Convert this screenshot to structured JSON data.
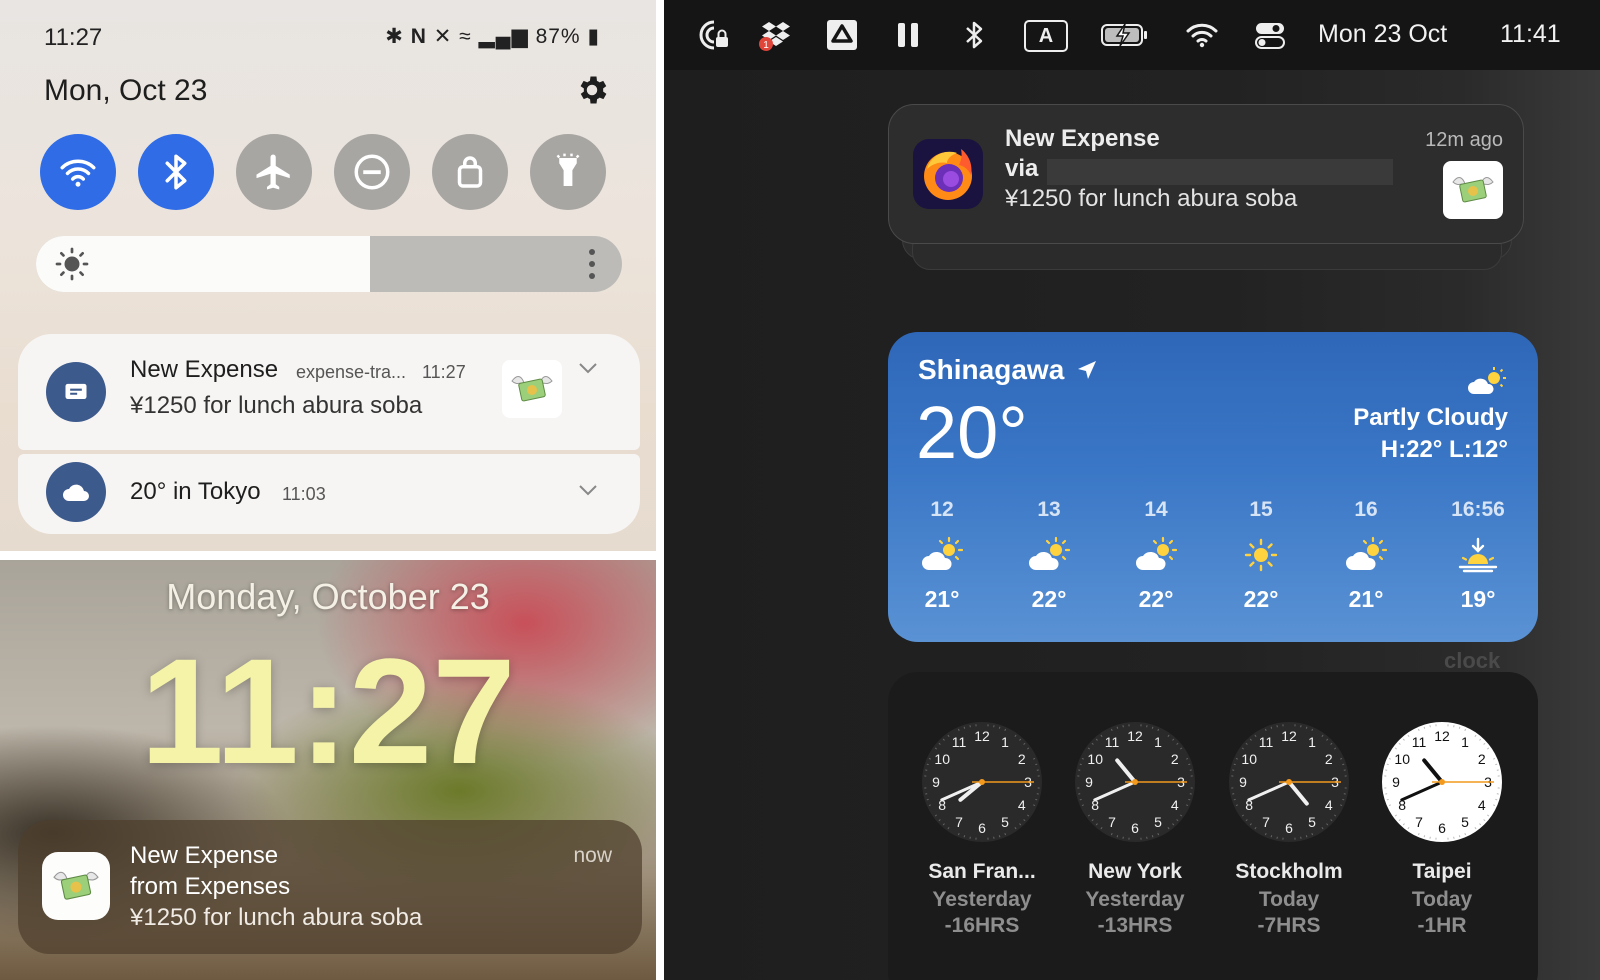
{
  "android": {
    "status_time": "11:27",
    "status_icons_text": "✱ Ⓝ ✕ ≈ ▐ 87%",
    "battery": "87%",
    "date": "Mon, Oct 23",
    "quick_settings": [
      {
        "icon": "wifi-icon",
        "state": "on"
      },
      {
        "icon": "bluetooth-icon",
        "state": "on"
      },
      {
        "icon": "airplane-icon",
        "state": "off"
      },
      {
        "icon": "do-not-disturb-icon",
        "state": "off"
      },
      {
        "icon": "lock-icon",
        "state": "off"
      },
      {
        "icon": "flashlight-icon",
        "state": "off"
      }
    ],
    "brightness_level": 0.57,
    "notifications": [
      {
        "title": "New Expense",
        "app": "expense-tra...",
        "time": "11:27",
        "body": "¥1250 for lunch abura soba",
        "icon": "message-icon"
      },
      {
        "title": "20° in Tokyo",
        "time": "11:03",
        "icon": "cloud-icon"
      }
    ],
    "accent_color": "#2f6ce5"
  },
  "ios": {
    "lock_date": "Monday, October 23",
    "lock_time": "11:27",
    "notification": {
      "line1": "New Expense",
      "line2": "from Expenses",
      "body": "¥1250 for lunch abura soba",
      "time": "now"
    }
  },
  "mac": {
    "menubar": {
      "icons": [
        "vpn-lock-icon",
        "dropbox-icon",
        "drive-icon",
        "pause-icon",
        "bluetooth-icon",
        "input-source-icon",
        "battery-charging-icon",
        "wifi-icon",
        "control-center-icon"
      ],
      "dropbox_badge": "1",
      "input_source": "A",
      "date": "Mon 23 Oct",
      "time": "11:41"
    },
    "notification": {
      "title": "New Expense",
      "via": "via",
      "body": "¥1250 for lunch abura soba",
      "ago": "12m ago",
      "app_icon": "firefox-icon"
    },
    "weather": {
      "location": "Shinagawa",
      "temp": "20°",
      "condition": "Partly Cloudy",
      "high_low": "H:22° L:12°",
      "hourly": [
        {
          "hour": "12",
          "temp": "21°",
          "icon": "partly-cloudy-icon"
        },
        {
          "hour": "13",
          "temp": "22°",
          "icon": "partly-cloudy-icon"
        },
        {
          "hour": "14",
          "temp": "22°",
          "icon": "partly-cloudy-icon"
        },
        {
          "hour": "15",
          "temp": "22°",
          "icon": "sun-icon"
        },
        {
          "hour": "16",
          "temp": "21°",
          "icon": "partly-cloudy-icon"
        },
        {
          "hour": "16:56",
          "temp": "19°",
          "icon": "sunset-icon"
        }
      ]
    },
    "world_clock": {
      "ghost_label": "clock",
      "cities": [
        {
          "city": "San Fran...",
          "day": "Yesterday",
          "offset": "-16HRS",
          "hour": 7,
          "minute": 41,
          "second": 15,
          "face": "dark"
        },
        {
          "city": "New York",
          "day": "Yesterday",
          "offset": "-13HRS",
          "hour": 10,
          "minute": 41,
          "second": 15,
          "face": "dark"
        },
        {
          "city": "Stockholm",
          "day": "Today",
          "offset": "-7HRS",
          "hour": 4,
          "minute": 41,
          "second": 15,
          "face": "dark"
        },
        {
          "city": "Taipei",
          "day": "Today",
          "offset": "-1HR",
          "hour": 10,
          "minute": 41,
          "second": 15,
          "face": "light"
        }
      ]
    }
  }
}
